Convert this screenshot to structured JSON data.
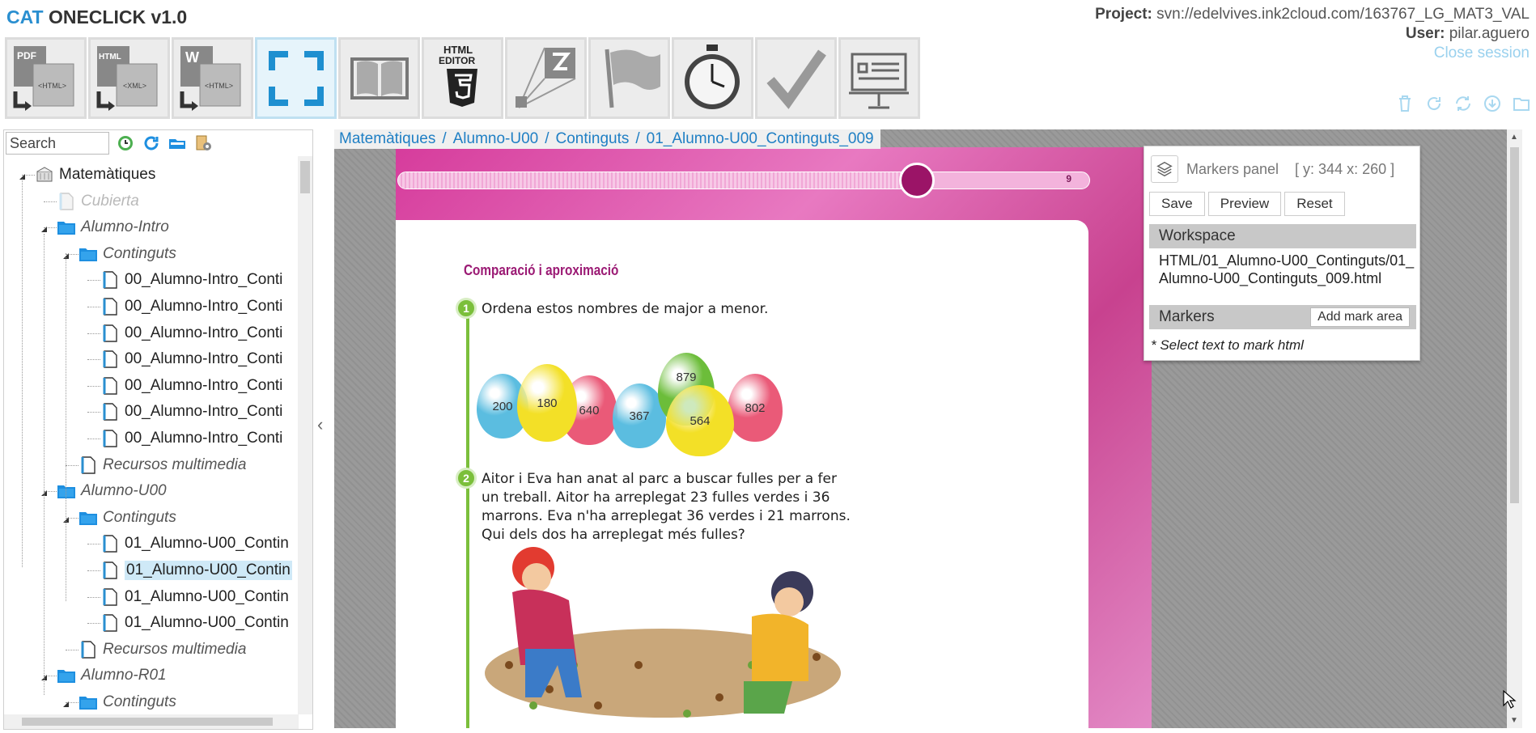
{
  "app": {
    "title_brand": "CAT",
    "title_rest": "ONECLICK v1.0"
  },
  "toolbar": [
    {
      "name": "pdf-to-html-tool",
      "tooltip": "PDF → HTML"
    },
    {
      "name": "html-to-xml-tool",
      "tooltip": "HTML → XML"
    },
    {
      "name": "word-to-html-tool",
      "tooltip": "W → HTML"
    },
    {
      "name": "fullscreen-tool",
      "tooltip": "Fullscreen"
    },
    {
      "name": "book-tool",
      "tooltip": "Book"
    },
    {
      "name": "html-editor-tool",
      "tooltip": "HTML EDITOR"
    },
    {
      "name": "zoom-area-tool",
      "tooltip": "Zoom"
    },
    {
      "name": "flag-tool",
      "tooltip": "Flag"
    },
    {
      "name": "timer-tool",
      "tooltip": "Timer"
    },
    {
      "name": "validate-tool",
      "tooltip": "Validate"
    },
    {
      "name": "presentation-tool",
      "tooltip": "Presentation"
    }
  ],
  "toolbar_labels": {
    "html_editor_line1": "HTML",
    "html_editor_line2": "EDITOR",
    "pdf": "PDF",
    "html": "<HTML>",
    "xml": "<XML>",
    "html_small": "HTML",
    "w": "W",
    "html2": "<HTML>"
  },
  "project": {
    "project_label": "Project:",
    "project_value": "svn://edelvives.ink2cloud.com/163767_LG_MAT3_VAL",
    "user_label": "User:",
    "user_value": "pilar.aguero",
    "close_session": "Close session"
  },
  "search": {
    "placeholder": "Search"
  },
  "breadcrumb": [
    "Matemàtiques",
    "Alumno-U00",
    "Continguts",
    "01_Alumno-U00_Continguts_009"
  ],
  "breadcrumb_sep": "/",
  "tree": [
    {
      "label": "Matemàtiques",
      "type": "root",
      "level": 0
    },
    {
      "label": "Cubierta",
      "type": "page-disabled",
      "level": 1
    },
    {
      "label": "Alumno-Intro",
      "type": "folder",
      "level": 1
    },
    {
      "label": "Continguts",
      "type": "folder",
      "level": 2
    },
    {
      "label": "00_Alumno-Intro_Conti",
      "type": "file",
      "level": 3
    },
    {
      "label": "00_Alumno-Intro_Conti",
      "type": "file",
      "level": 3
    },
    {
      "label": "00_Alumno-Intro_Conti",
      "type": "file",
      "level": 3
    },
    {
      "label": "00_Alumno-Intro_Conti",
      "type": "file",
      "level": 3
    },
    {
      "label": "00_Alumno-Intro_Conti",
      "type": "file",
      "level": 3
    },
    {
      "label": "00_Alumno-Intro_Conti",
      "type": "file",
      "level": 3
    },
    {
      "label": "00_Alumno-Intro_Conti",
      "type": "file",
      "level": 3
    },
    {
      "label": "Recursos multimedia",
      "type": "file-italic",
      "level": 2
    },
    {
      "label": "Alumno-U00",
      "type": "folder",
      "level": 1
    },
    {
      "label": "Continguts",
      "type": "folder",
      "level": 2
    },
    {
      "label": "01_Alumno-U00_Contin",
      "type": "file",
      "level": 3
    },
    {
      "label": "01_Alumno-U00_Contin",
      "type": "file-selected",
      "level": 3
    },
    {
      "label": "01_Alumno-U00_Contin",
      "type": "file",
      "level": 3
    },
    {
      "label": "01_Alumno-U00_Contin",
      "type": "file",
      "level": 3
    },
    {
      "label": "Recursos multimedia",
      "type": "file-italic",
      "level": 2
    },
    {
      "label": "Alumno-R01",
      "type": "folder",
      "level": 1
    },
    {
      "label": "Continguts",
      "type": "folder",
      "level": 2
    }
  ],
  "page": {
    "page_number": "9",
    "progress_fraction": 0.75,
    "section_title": "Comparació i aproximació",
    "q1_number": "1",
    "q1_text": "Ordena estos nombres de major a menor.",
    "eggs": [
      {
        "value": "200",
        "color": "#5bbde0"
      },
      {
        "value": "180",
        "color": "#f3e027"
      },
      {
        "value": "640",
        "color": "#ea5a78"
      },
      {
        "value": "367",
        "color": "#5bbde0"
      },
      {
        "value": "879",
        "color": "#6cbd3a"
      },
      {
        "value": "564",
        "color": "#f3e027"
      },
      {
        "value": "802",
        "color": "#ea5a78"
      }
    ],
    "q2_number": "2",
    "q2_text": "Aitor i Eva han anat al parc a buscar fulles per a fer un treball. Aitor ha arreplegat 23 fulles verdes i 36 marrons. Eva n'ha arreplegat 36 verdes i 21 marrons. Qui dels dos ha arreplegat més fulles?"
  },
  "markers_panel": {
    "title": "Markers panel",
    "coords": "[ y: 344 x: 260 ]",
    "save": "Save",
    "preview": "Preview",
    "reset": "Reset",
    "workspace_label": "Workspace",
    "workspace_path": "HTML/01_Alumno-U00_Continguts/01_Alumno-U00_Continguts_009.html",
    "markers_label": "Markers",
    "add_mark_area": "Add mark area",
    "hint": "* Select text to mark html"
  },
  "colors": {
    "accent": "#2a8fd0",
    "link": "#1f7fc4",
    "close_session": "#9ad1ee",
    "folder": "#1e8fe0",
    "page_magenta": "#d63c9c"
  }
}
